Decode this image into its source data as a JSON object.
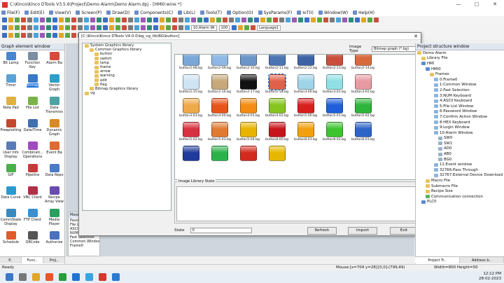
{
  "titlebar": {
    "title": "C:\\Kinco\\Kinco DTools V3.5.6\\Project\\Demo Alarm\\Demo Alarm.dpj - [HMI0:wine *]",
    "buttons": [
      "—",
      "▢",
      "✕"
    ]
  },
  "menu": [
    "File(F)",
    "Edit(E)",
    "View(V)",
    "Screen(P)",
    "Draw(D)",
    "Components(C)",
    "Lib(L)",
    "Tools(T)",
    "Option(O)",
    "SysParams(F)",
    "IoT(I)",
    "Window(W)",
    "Help(H)"
  ],
  "toolbar2": {
    "alarm_select": "10:Alarm Wi",
    "zoom": "100",
    "language": "Language1"
  },
  "left_panel": {
    "title": "Graph element window",
    "items": [
      "Bit Lamp",
      "Function Key",
      "Alarm Ba",
      "Timer",
      "Bitmap",
      "Vector Graph",
      "Note Pad",
      "File List",
      "Data Transmiss",
      "Freeplotting",
      "Date/Time",
      "Dynamic Graph",
      "User Info Display",
      "Combinati... Operations",
      "Event Ba",
      "GIF",
      "Pipeline",
      "Data Repo",
      "Data Curve",
      "VNC Client",
      "Recipe Array View",
      "CommState Display",
      "FTP Client",
      "Media Player",
      "Schedule",
      "QRCode",
      "Authorize"
    ],
    "tabs": [
      "P..",
      "Func..",
      "Proj.."
    ]
  },
  "message_panel": {
    "title": "Messa...",
    "lines": [
      "Passwo",
      "File Lis",
      "ASCII",
      "NUM",
      "Fast Selection",
      "Common Window",
      "Frame0"
    ]
  },
  "dialog": {
    "title": "[C:\\Kinco\\Kinco DTools V4.0.0\\bg_vg_lib\\BG\\button]",
    "close": "✕",
    "tree": [
      {
        "text": "System Graphics library",
        "depth": 0
      },
      {
        "text": "Common Graphics library",
        "depth": 1
      },
      {
        "text": "button",
        "depth": 2
      },
      {
        "text": "switch",
        "depth": 2
      },
      {
        "text": "lamp",
        "depth": 2
      },
      {
        "text": "frame",
        "depth": 2
      },
      {
        "text": "arrow",
        "depth": 2
      },
      {
        "text": "warning",
        "depth": 2
      },
      {
        "text": "edit",
        "depth": 2
      },
      {
        "text": "flag",
        "depth": 2
      },
      {
        "text": "Bitmap Graphics library",
        "depth": 1
      },
      {
        "text": "vg",
        "depth": 0
      }
    ],
    "image_type_label": "Image Type",
    "image_type_value": "Bitmap graph (*.bg)",
    "thumbnails": [
      {
        "label": "button2-08.bg",
        "color": "#7aa6d8"
      },
      {
        "label": "button2-09.bg",
        "color": "#8fb9e4"
      },
      {
        "label": "button2-10.bg",
        "color": "#6b95c8"
      },
      {
        "label": "button2-11.bg",
        "color": "#4b74b2"
      },
      {
        "label": "button2-12.bg",
        "color": "#3d63a6"
      },
      {
        "label": "button2-13.bg",
        "color": "#c94f3c"
      },
      {
        "label": "button2-14.bg",
        "color": "#d96a3c"
      },
      {
        "label": "",
        "color": ""
      },
      {
        "label": "button2-15.bg",
        "color": "#cfe4f3"
      },
      {
        "label": "button2-16.bg",
        "color": "#c7a87a"
      },
      {
        "label": "button2-17.bg",
        "color": "#111111"
      },
      {
        "label": "button2-18.bg",
        "color": "#e06049"
      },
      {
        "label": "button3-00.bg",
        "color": "#9fd4e8"
      },
      {
        "label": "button3-01.bg",
        "color": "#8fe0e4"
      },
      {
        "label": "button3-02.bg",
        "color": "#e79aa2"
      },
      {
        "label": "",
        "color": ""
      },
      {
        "label": "button3-03.bg",
        "color": "#f0a94a"
      },
      {
        "label": "button4-00.bg",
        "color": "#e8541c"
      },
      {
        "label": "button4-01.bg",
        "color": "#f28c12"
      },
      {
        "label": "button4-02.bg",
        "color": "#86c51e"
      },
      {
        "label": "button5-00.bg",
        "color": "#d91e1e"
      },
      {
        "label": "button5-01.bg",
        "color": "#1e5fd9"
      },
      {
        "label": "button5-02.bg",
        "color": "#2cb53a"
      },
      {
        "label": "",
        "color": ""
      },
      {
        "label": "button5-02.bg",
        "color": "#d83040"
      },
      {
        "label": "button5-03.bg",
        "color": "#e07a32"
      },
      {
        "label": "button5-04.bg",
        "color": "#e8b400"
      },
      {
        "label": "button8-00.bg",
        "color": "#c7141a"
      },
      {
        "label": "button8-01.bg",
        "color": "#f2a10c"
      },
      {
        "label": "button8-02.bg",
        "color": "#3cc42e"
      },
      {
        "label": "button8-03.bg",
        "color": "#2d64c8"
      },
      {
        "label": "",
        "color": ""
      },
      {
        "label": "",
        "color": "#1f3a9a"
      },
      {
        "label": "",
        "color": "#2bb34a"
      },
      {
        "label": "",
        "color": "#d42a1e"
      },
      {
        "label": "",
        "color": "#e6b800"
      }
    ],
    "highlighted": "button2-18.bg",
    "state_group_label": "Image Library State",
    "state_label": "State",
    "state_value": "0",
    "buttons": {
      "refresh": "Refresh",
      "import": "Import",
      "exit": "Exit"
    }
  },
  "right_panel": {
    "title": "Project structure window",
    "rows": [
      {
        "text": "Demo Alarm",
        "indent": 0,
        "icon": "#e8c35a"
      },
      {
        "text": "Library File",
        "indent": 1,
        "icon": "#e8c35a"
      },
      {
        "text": "HMI",
        "indent": 1,
        "icon": "#5b8bd1"
      },
      {
        "text": "HMI0",
        "indent": 2,
        "icon": "#5b8bd1"
      },
      {
        "text": "Frames",
        "indent": 3,
        "icon": "#e8c35a"
      },
      {
        "text": "0:Frame0",
        "indent": 4,
        "icon": "#8cb4e0"
      },
      {
        "text": "1:Common Window",
        "indent": 4,
        "icon": "#8cb4e0"
      },
      {
        "text": "2:Fast Selection",
        "indent": 4,
        "icon": "#8cb4e0"
      },
      {
        "text": "3:NUM Keyboard",
        "indent": 4,
        "icon": "#8cb4e0"
      },
      {
        "text": "4:ASCII Keyboard",
        "indent": 4,
        "icon": "#8cb4e0"
      },
      {
        "text": "5:File List Window",
        "indent": 4,
        "icon": "#8cb4e0"
      },
      {
        "text": "6:Password Window",
        "indent": 4,
        "icon": "#8cb4e0"
      },
      {
        "text": "7:Confirm Action Window",
        "indent": 4,
        "icon": "#8cb4e0"
      },
      {
        "text": "8:HEX Keyboard",
        "indent": 4,
        "icon": "#8cb4e0"
      },
      {
        "text": "9:Login Window",
        "indent": 4,
        "icon": "#8cb4e0"
      },
      {
        "text": "10:Alarm Window",
        "indent": 4,
        "icon": "#8cb4e0"
      },
      {
        "text": "SW0",
        "indent": 5,
        "icon": "#9ab0c8"
      },
      {
        "text": "SW1",
        "indent": 5,
        "icon": "#9ab0c8"
      },
      {
        "text": "AD0",
        "indent": 5,
        "icon": "#9ab0c8"
      },
      {
        "text": "AB0",
        "indent": 5,
        "icon": "#9ab0c8"
      },
      {
        "text": "BG0",
        "indent": 5,
        "icon": "#9ab0c8"
      },
      {
        "text": "11:Event window",
        "indent": 4,
        "icon": "#8cb4e0"
      },
      {
        "text": "32766:Pass Through",
        "indent": 4,
        "icon": "#8cb4e0"
      },
      {
        "text": "32767:External Device Download",
        "indent": 4,
        "icon": "#8cb4e0"
      },
      {
        "text": "Macro File",
        "indent": 2,
        "icon": "#e8c35a"
      },
      {
        "text": "Submacro File",
        "indent": 2,
        "icon": "#e8c35a"
      },
      {
        "text": "Recipe Size",
        "indent": 2,
        "icon": "#e8c35a"
      },
      {
        "text": "Communication connection",
        "indent": 2,
        "icon": "#5bb35b"
      },
      {
        "text": "PLC0",
        "indent": 1,
        "icon": "#5b8bd1"
      }
    ],
    "tabs": [
      "Project Tr..",
      "Address b.."
    ]
  },
  "statusbar": {
    "left": "Ready",
    "mouse": "Mouse:[x=704  y=28]",
    "coords": "[0,0]-(799,49)",
    "size": "Width=800 Height=50"
  },
  "taskbar": {
    "time": "12:12 PM",
    "date": "28-02-2023",
    "icon_colors": [
      "#3a78c8",
      "#777777",
      "#e0a628",
      "#e8562a",
      "#2a9c3a",
      "#1e73d2",
      "#3aa3e0",
      "#d9352a",
      "#2a7ad0"
    ]
  }
}
